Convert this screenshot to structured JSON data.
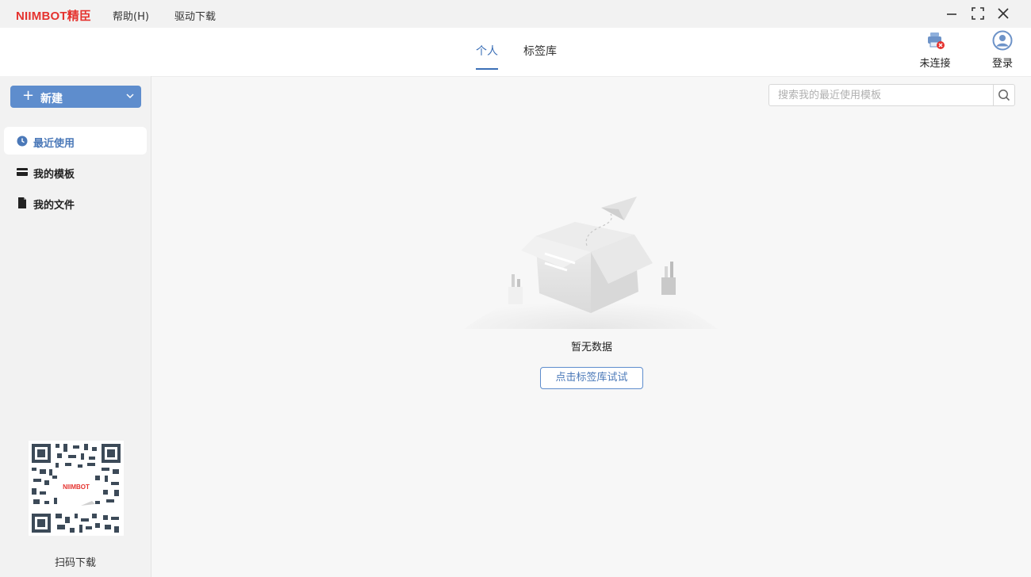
{
  "app": {
    "brand": "NIIMBOT精臣"
  },
  "menu": {
    "help": "帮助(H)",
    "driver_download": "驱动下载"
  },
  "header": {
    "tabs": [
      {
        "label": "个人",
        "active": true
      },
      {
        "label": "标签库",
        "active": false
      }
    ],
    "printer_status": "未连接",
    "login": "登录"
  },
  "sidebar": {
    "new_button": "新建",
    "items": [
      {
        "label": "最近使用",
        "icon": "clock-icon",
        "active": true
      },
      {
        "label": "我的模板",
        "icon": "template-card-icon",
        "active": false
      },
      {
        "label": "我的文件",
        "icon": "file-icon",
        "active": false
      }
    ],
    "qr_brand": "NIIMBOT",
    "qr_label": "扫码下载"
  },
  "main": {
    "search_placeholder": "搜索我的最近使用模板",
    "empty_text": "暂无数据",
    "try_button": "点击标签库试试"
  },
  "colors": {
    "accent": "#5e8dcd",
    "brand": "#e5332f",
    "active_text": "#4a78b8"
  }
}
